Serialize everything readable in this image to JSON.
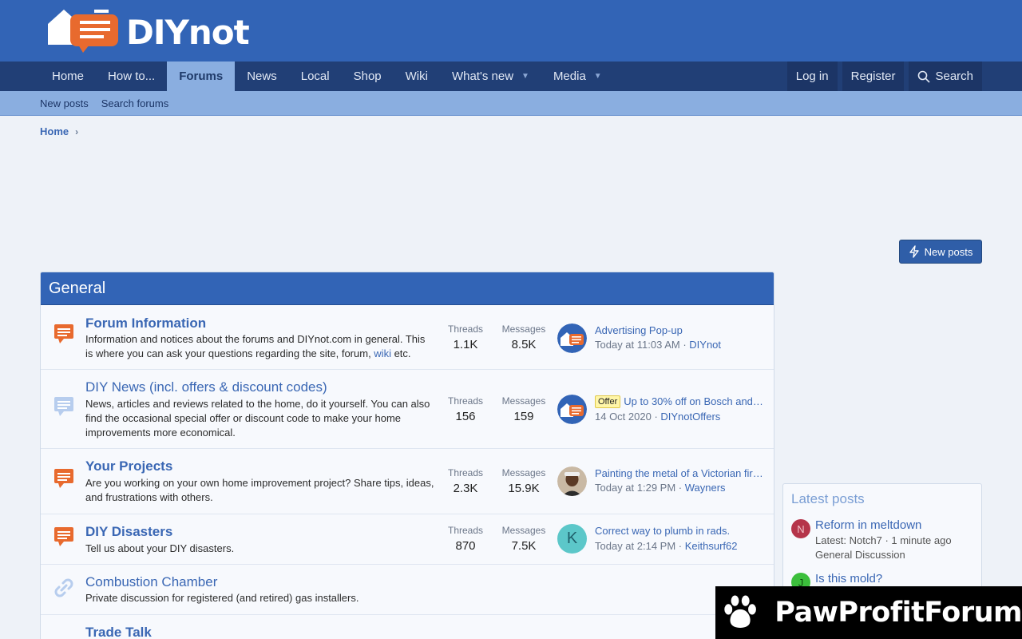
{
  "header": {
    "logo_text": "DIYnot"
  },
  "nav": {
    "items": [
      {
        "label": "Home"
      },
      {
        "label": "How to..."
      },
      {
        "label": "Forums"
      },
      {
        "label": "News"
      },
      {
        "label": "Local"
      },
      {
        "label": "Shop"
      },
      {
        "label": "Wiki"
      },
      {
        "label": "What's new"
      },
      {
        "label": "Media"
      }
    ],
    "active": "Forums",
    "login_label": "Log in",
    "register_label": "Register",
    "search_label": "Search"
  },
  "subnav": {
    "items": [
      {
        "label": "New posts"
      },
      {
        "label": "Search forums"
      }
    ]
  },
  "breadcrumb": {
    "home": "Home"
  },
  "new_posts_button": "New posts",
  "block": {
    "title": "General",
    "forums": [
      {
        "title": "Forum Information",
        "desc_before": "Information and notices about the forums and DIYnot.com in general. This is where you can ask your questions regarding the site, forum, ",
        "desc_link": "wiki",
        "desc_after": " etc.",
        "threads_label": "Threads",
        "threads": "1.1K",
        "messages_label": "Messages",
        "messages": "8.5K",
        "last_title": "Advertising Pop-up",
        "last_time": "Today at 11:03 AM",
        "last_user": "DIYnot"
      },
      {
        "title": "DIY News (incl. offers & discount codes)",
        "desc": "News, articles and reviews related to the home, do it yourself. You can also find the occasional special offer or discount code to make your home improvements more economical.",
        "threads_label": "Threads",
        "threads": "156",
        "messages_label": "Messages",
        "messages": "159",
        "last_badge": "Offer",
        "last_title": "Up to 30% off on Bosch and…",
        "last_time": "14 Oct 2020",
        "last_user": "DIYnotOffers"
      },
      {
        "title": "Your Projects",
        "desc": "Are you working on your own home improvement project? Share tips, ideas, and frustrations with others.",
        "threads_label": "Threads",
        "threads": "2.3K",
        "messages_label": "Messages",
        "messages": "15.9K",
        "last_title": "Painting the metal of a Victorian fir…",
        "last_time": "Today at 1:29 PM",
        "last_user": "Wayners"
      },
      {
        "title": "DIY Disasters",
        "desc": "Tell us about your DIY disasters.",
        "threads_label": "Threads",
        "threads": "870",
        "messages_label": "Messages",
        "messages": "7.5K",
        "last_avatar_letter": "K",
        "last_title": "Correct way to plumb in rads.",
        "last_time": "Today at 2:14 PM",
        "last_user": "Keithsurf62"
      },
      {
        "title": "Combustion Chamber",
        "desc": "Private discussion for registered (and retired) gas installers."
      },
      {
        "title": "Trade Talk"
      }
    ]
  },
  "sidebar": {
    "title": "Latest posts",
    "posts": [
      {
        "avatar": "N",
        "avatar_color": "#b5344a",
        "title": "Reform in meltdown",
        "meta": "Latest: Notch7 · 1 minute ago",
        "forum": "General Discussion"
      },
      {
        "avatar": "J",
        "avatar_color": "#3cbf3c",
        "title": "Is this mold?"
      }
    ]
  },
  "watermark": {
    "text": "PawProfitForum"
  },
  "colors": {
    "brand_blue": "#3264b6",
    "nav_dark": "#213f76",
    "subnav": "#8aaee0",
    "accent_orange": "#e86a2e"
  }
}
